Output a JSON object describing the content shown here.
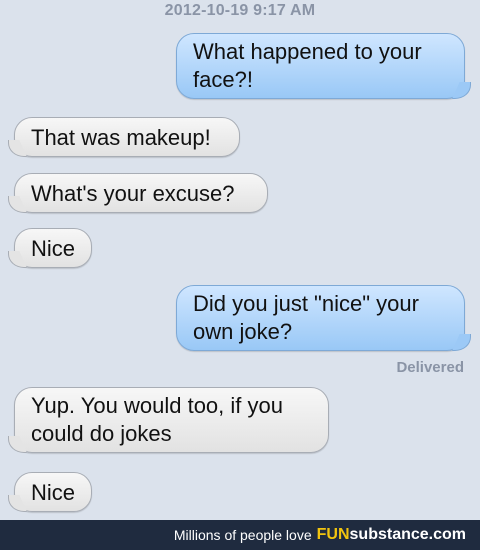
{
  "conversation": {
    "timestamp": "2012-10-19 9:17 AM",
    "messages": [
      {
        "direction": "sent",
        "lines": [
          "What happened to your",
          "face?!"
        ]
      },
      {
        "direction": "received",
        "lines": [
          "That was makeup!"
        ]
      },
      {
        "direction": "received",
        "lines": [
          "What's your excuse?"
        ]
      },
      {
        "direction": "received",
        "lines": [
          "Nice"
        ]
      },
      {
        "direction": "sent",
        "lines": [
          "Did you just \"nice\" your",
          "own joke?"
        ]
      },
      {
        "direction": "received",
        "lines": [
          "Yup. You would too, if you",
          "could do jokes"
        ]
      },
      {
        "direction": "received",
        "lines": [
          "Nice"
        ]
      }
    ],
    "status": "Delivered"
  },
  "footer": {
    "tagline": "Millions of people love",
    "brand_part1": "FUN",
    "brand_part2": "substance.com"
  },
  "colors": {
    "background": "#dbe2ec",
    "sent_bubble": "#99c8f6",
    "received_bubble": "#e8e8e8",
    "footer_bg": "#1f2b3f",
    "brand_accent": "#f1c40f"
  }
}
